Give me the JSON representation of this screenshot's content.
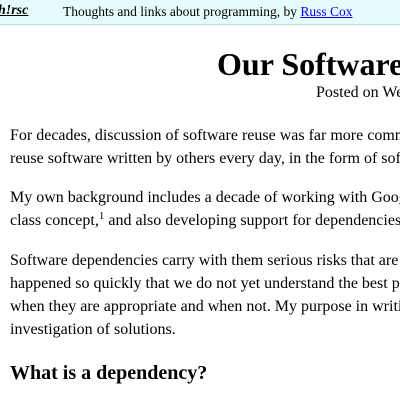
{
  "header": {
    "logo": "h!rsc",
    "tagline_prefix": "Thoughts and links about programming, by ",
    "author": "Russ Cox"
  },
  "article": {
    "title": "Our Software",
    "posted": "Posted on We",
    "p1": [
      "For decades, discussion of software reuse was far more comm",
      "reuse software written by others every day, in the form of sof"
    ],
    "p2_line1": "My own background includes a decade of working with Goog",
    "p2_line2_before": "class concept,",
    "p2_footnote": "1",
    "p2_line2_after": " and also developing support for dependencies",
    "p3": [
      "Software dependencies carry with them serious risks that are",
      "happened so quickly that we do not yet understand the best p",
      "when they are appropriate and when not. My purpose in writi",
      "investigation of solutions."
    ],
    "section_heading": "What is a dependency?"
  }
}
